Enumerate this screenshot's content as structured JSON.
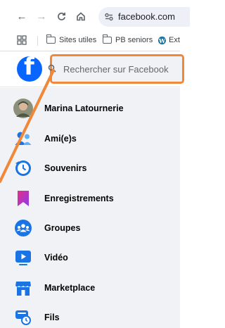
{
  "browser": {
    "url": "facebook.com",
    "bookmarks": [
      {
        "label": "Sites utiles"
      },
      {
        "label": "PB seniors"
      },
      {
        "label": "Ext"
      }
    ]
  },
  "facebook": {
    "logo_letter": "f",
    "search_placeholder": "Rechercher sur Facebook",
    "brand_color": "#0866ff",
    "sidebar": [
      {
        "label": "Marina Latournerie",
        "icon": "profile-avatar"
      },
      {
        "label": "Ami(e)s",
        "icon": "friends-icon"
      },
      {
        "label": "Souvenirs",
        "icon": "memories-clock-icon"
      },
      {
        "label": "Enregistrements",
        "icon": "bookmark-icon"
      },
      {
        "label": "Groupes",
        "icon": "groups-icon"
      },
      {
        "label": "Vidéo",
        "icon": "video-icon"
      },
      {
        "label": "Marketplace",
        "icon": "marketplace-icon"
      },
      {
        "label": "Fils",
        "icon": "feeds-icon"
      }
    ]
  },
  "annotation": {
    "color": "#f0883a"
  }
}
